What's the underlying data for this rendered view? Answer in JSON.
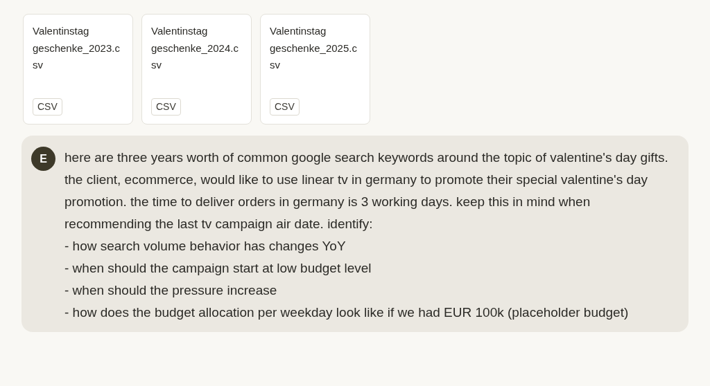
{
  "attachments": [
    {
      "name": "Valentinstag geschenke_2023.csv",
      "type": "CSV"
    },
    {
      "name": "Valentinstag geschenke_2024.csv",
      "type": "CSV"
    },
    {
      "name": "Valentinstag geschenke_2025.csv",
      "type": "CSV"
    }
  ],
  "message": {
    "avatar": "E",
    "paragraphs": [
      "here are three years worth of common google search keywords around the topic of valentine's day gifts. the client, ecommerce, would like to use linear tv in germany to promote their special valentine's day promotion. the time to deliver orders in germany is 3 working days. keep this in mind when recommending the last tv campaign air date. identify:",
      "- how search volume behavior has changes YoY",
      "- when should the campaign start at low budget level",
      "- when should the pressure increase",
      "- how does the budget allocation per weekday look like if we had EUR 100k (placeholder budget)"
    ]
  }
}
